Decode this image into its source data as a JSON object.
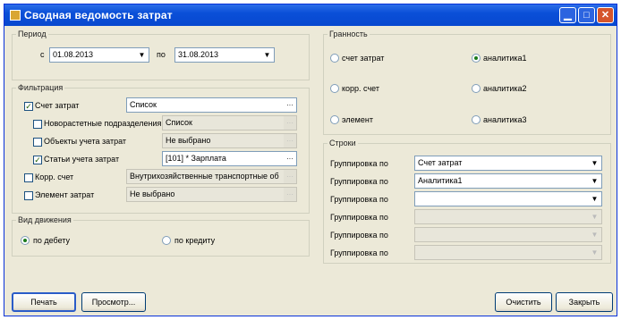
{
  "window": {
    "title": "Сводная ведомость затрат"
  },
  "period": {
    "legend": "Период",
    "from_prefix": "с",
    "from_value": "01.08.2013",
    "to_prefix": "по",
    "to_value": "31.08.2013"
  },
  "filtration": {
    "legend": "Фильтрация",
    "rows": [
      {
        "label": "Счет затрат",
        "checked": true,
        "value": "Список"
      },
      {
        "label": "Новорастетные подразделения",
        "checked": false,
        "value": "Список"
      },
      {
        "label": "Объекты учета затрат",
        "checked": false,
        "value": "Не выбрано"
      },
      {
        "label": "Статьи учета затрат",
        "checked": true,
        "value": "[101] * Зарплата"
      },
      {
        "label": "Корр. счет",
        "checked": false,
        "value": "Внутрихозяйственные транспортные об"
      },
      {
        "label": "Элемент затрат",
        "checked": false,
        "value": "Не выбрано"
      }
    ]
  },
  "movement": {
    "legend": "Вид движения",
    "options": [
      {
        "label": "по дебету",
        "selected": true
      },
      {
        "label": "по кредиту",
        "selected": false
      }
    ]
  },
  "detail": {
    "legend": "Гранность",
    "options": [
      {
        "label": "счет затрат",
        "selected": false
      },
      {
        "label": "аналитика1",
        "selected": true
      },
      {
        "label": "корр. счет",
        "selected": false
      },
      {
        "label": "аналитика2",
        "selected": false
      },
      {
        "label": "элемент",
        "selected": false
      },
      {
        "label": "аналитика3",
        "selected": false
      }
    ]
  },
  "rows_group": {
    "legend": "Строки",
    "rows": [
      {
        "label": "Группировка по",
        "value": "Счет затрат",
        "enabled": true
      },
      {
        "label": "Группировка по",
        "value": "Аналитика1",
        "enabled": true
      },
      {
        "label": "Группировка по",
        "value": "",
        "enabled": true
      },
      {
        "label": "Группировка по",
        "value": "",
        "enabled": false
      },
      {
        "label": "Группировка по",
        "value": "",
        "enabled": false
      },
      {
        "label": "Группировка по",
        "value": "",
        "enabled": false
      }
    ]
  },
  "buttons": {
    "print": "Печать",
    "preview": "Просмотр...",
    "clear": "Очистить",
    "close": "Закрыть"
  },
  "icons": {
    "app": "app-icon",
    "minimize": "minimize-icon",
    "maximize": "maximize-icon",
    "close": "close-icon"
  },
  "colors": {
    "titlebar": "#0a4fd8",
    "window_bg": "#ece9d8",
    "close_button": "#d5552c"
  }
}
